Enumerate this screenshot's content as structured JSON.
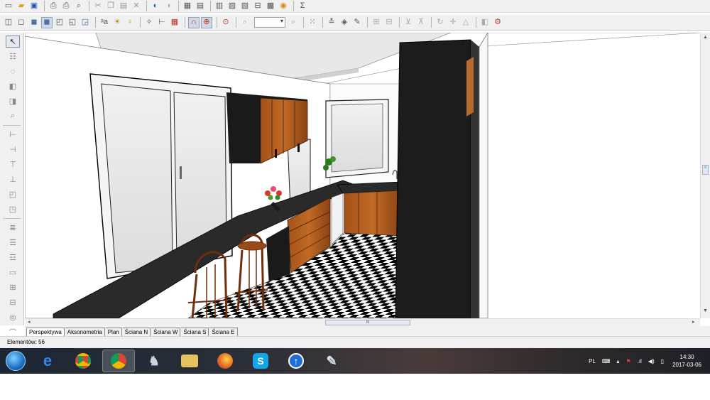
{
  "toolbar_top": {
    "buttons": [
      "new-file",
      "open-folder",
      "save",
      "print-setup",
      "print",
      "print-preview",
      "cut",
      "copy",
      "paste",
      "delete",
      "undo",
      "redo",
      "properties",
      "table-view",
      "layers",
      "list-view",
      "object-list",
      "measure",
      "render",
      "render-settings",
      "sum"
    ],
    "sum_glyph": "Σ"
  },
  "toolbar_view": {
    "zoom_value": ""
  },
  "tabs": [
    {
      "label": "Perspektywa",
      "active": true
    },
    {
      "label": "Aksonometria",
      "active": false
    },
    {
      "label": "Plan",
      "active": false
    },
    {
      "label": "Ściana N",
      "active": false
    },
    {
      "label": "Ściana W",
      "active": false
    },
    {
      "label": "Ściana S",
      "active": false
    },
    {
      "label": "Ściana E",
      "active": false
    }
  ],
  "status_bar": {
    "elements_text": "Elementów: 56"
  },
  "scroll": {
    "h_thumb_glyph": "III",
    "v_thumb_glyph": "≡"
  },
  "taskbar": {
    "apps": [
      {
        "name": "internet-explorer",
        "glyph": "e",
        "color": "#1e73d8"
      },
      {
        "name": "chrome",
        "glyph": "●",
        "color": "#e8b100"
      },
      {
        "name": "chrome-active",
        "glyph": "●",
        "color": "#e8b100"
      },
      {
        "name": "kitchen-design-app",
        "glyph": "♞",
        "color": "#6d7d94"
      },
      {
        "name": "file-explorer",
        "glyph": "▤",
        "color": "#e3c463"
      },
      {
        "name": "firefox",
        "glyph": "●",
        "color": "#e66b1d"
      },
      {
        "name": "skype",
        "glyph": "S",
        "color": "#12a5e8"
      },
      {
        "name": "upload-app",
        "glyph": "↑",
        "color": "#1f6fd6"
      },
      {
        "name": "paint",
        "glyph": "✎",
        "color": "#7d8896"
      }
    ],
    "tray": {
      "language": "PL",
      "time": "14:30",
      "date": "2017-03-06"
    }
  }
}
